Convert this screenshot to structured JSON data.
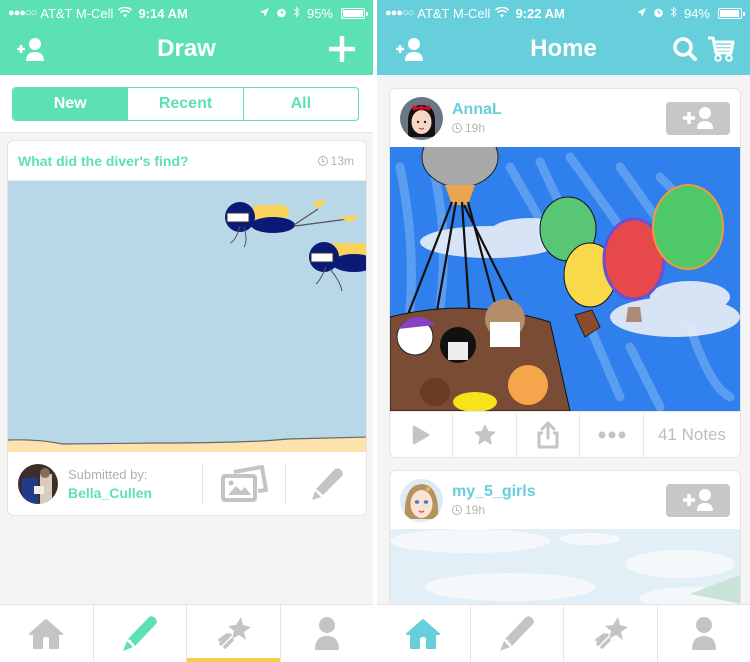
{
  "left_screen": {
    "status": {
      "signal": "●●●○○",
      "carrier": "AT&T M-Cell",
      "time": "9:14 AM",
      "battery_pct_label": "95%",
      "battery_level": 0.95
    },
    "nav": {
      "title": "Draw",
      "left_icon": "add-friend-icon",
      "right_icon": "plus-icon"
    },
    "segments": [
      {
        "label": "New",
        "active": true
      },
      {
        "label": "Recent",
        "active": false
      },
      {
        "label": "All",
        "active": false
      }
    ],
    "card": {
      "question": "What did the diver's find?",
      "age": "13m",
      "submitted_label": "Submitted by:",
      "submitter": "Bella_Cullen",
      "actions": [
        "gallery-icon",
        "pencil-icon"
      ]
    },
    "tabs": [
      {
        "icon": "home-icon",
        "active": false
      },
      {
        "icon": "pencil-icon",
        "active": true
      },
      {
        "icon": "shooting-star-icon",
        "active": false,
        "underlined": true
      },
      {
        "icon": "profile-icon",
        "active": false
      }
    ]
  },
  "right_screen": {
    "status": {
      "signal": "●●●○○",
      "carrier": "AT&T M-Cell",
      "time": "9:22 AM",
      "battery_pct_label": "94%",
      "battery_level": 0.94
    },
    "nav": {
      "title": "Home",
      "left_icon": "add-friend-icon",
      "right_icons": [
        "search-icon",
        "cart-icon"
      ]
    },
    "posts": [
      {
        "username": "AnnaL",
        "age": "19h",
        "notes": "41 Notes"
      },
      {
        "username": "my_5_girls",
        "age": "19h"
      }
    ],
    "tabs": [
      {
        "icon": "home-icon",
        "active": true
      },
      {
        "icon": "pencil-icon",
        "active": false
      },
      {
        "icon": "shooting-star-icon",
        "active": false
      },
      {
        "icon": "profile-icon",
        "active": false
      }
    ]
  },
  "colors": {
    "draw_accent": "#5ce1b4",
    "home_accent": "#66cfdb",
    "tab_underline": "#f8cc4b",
    "inactive_icon": "#c4c4c4"
  }
}
